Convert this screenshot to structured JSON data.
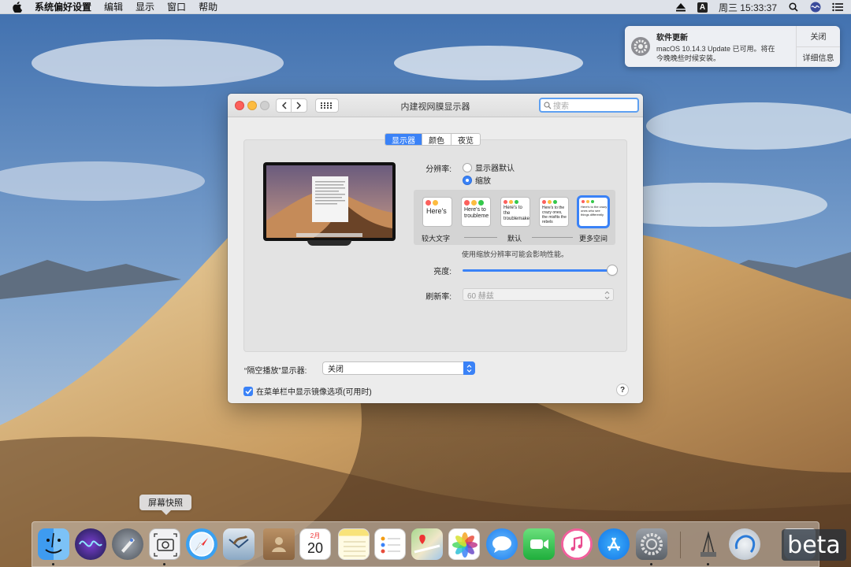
{
  "menubar": {
    "app_name": "系统偏好设置",
    "items": [
      "编辑",
      "显示",
      "窗口",
      "帮助"
    ],
    "input_method": "A",
    "clock": "周三 15:33:37"
  },
  "notification": {
    "title": "软件更新",
    "text": "macOS 10.14.3 Update 已可用。将在今晚晚些时候安装。",
    "close_label": "关闭",
    "details_label": "详细信息"
  },
  "window": {
    "title": "内建视网膜显示器",
    "search_placeholder": "搜索",
    "tabs": [
      "显示器",
      "颜色",
      "夜览"
    ],
    "active_tab": "显示器",
    "resolution_label": "分辨率:",
    "resolution_options": [
      "显示器默认",
      "缩放"
    ],
    "resolution_selected": "缩放",
    "scale_left_label": "较大文字",
    "scale_mid_label": "默认",
    "scale_right_label": "更多空间",
    "scale_thumb_texts": [
      "Here's",
      "Here's to troubleme",
      "Here's to the troublemakers",
      "Here's to the crazy ones, the misfits the rebels",
      "Here's to the crazy ones who see things differently"
    ],
    "scale_note": "使用缩放分辨率可能会影响性能。",
    "brightness_label": "亮度:",
    "brightness_value": 1.0,
    "refresh_label": "刷新率:",
    "refresh_value": "60 赫兹",
    "airplay_label": "“隔空播放”显示器:",
    "airplay_value": "关闭",
    "mirror_checkbox_label": "在菜单栏中显示镜像选项(可用时)",
    "mirror_checked": true,
    "help_label": "?"
  },
  "dock": {
    "tooltip": "屏幕快照",
    "calendar_month": "2月",
    "calendar_day": "20",
    "apps": [
      "finder",
      "siri",
      "launchpad",
      "screenshot",
      "safari",
      "mail",
      "contacts",
      "calendar",
      "notes",
      "reminders",
      "maps",
      "photos",
      "messages",
      "facetime",
      "itunes",
      "app-store",
      "system-preferences",
      "utility",
      "airdrop",
      "trash"
    ]
  },
  "watermark": "beta",
  "colors": {
    "accent": "#3a82f7",
    "close": "#fc605c",
    "minimize": "#fdbc40"
  }
}
